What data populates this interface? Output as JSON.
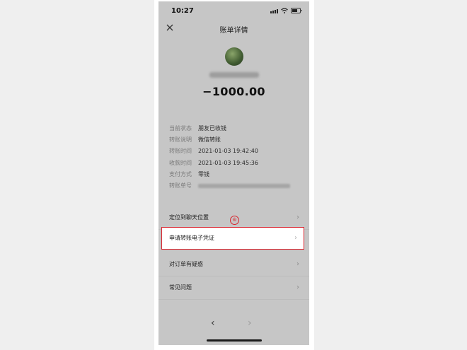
{
  "status": {
    "time": "10:27"
  },
  "nav": {
    "title": "账单详情",
    "close_icon": "close-icon"
  },
  "payee": {
    "amount": "−1000.00"
  },
  "details": [
    {
      "label": "当前状态",
      "value": "朋友已收钱"
    },
    {
      "label": "转账说明",
      "value": "微信转账"
    },
    {
      "label": "转账时间",
      "value": "2021-01-03 19:42:40"
    },
    {
      "label": "收款时间",
      "value": "2021-01-03 19:45:36"
    },
    {
      "label": "支付方式",
      "value": "零钱"
    },
    {
      "label": "转账单号",
      "value": ""
    }
  ],
  "menu": [
    {
      "label": "定位到聊天位置"
    },
    {
      "label": "申请转账电子凭证"
    },
    {
      "label": "对订单有疑惑"
    },
    {
      "label": "常见问题"
    }
  ],
  "annotation": {
    "step": "⑥",
    "color": "#d9232d"
  }
}
